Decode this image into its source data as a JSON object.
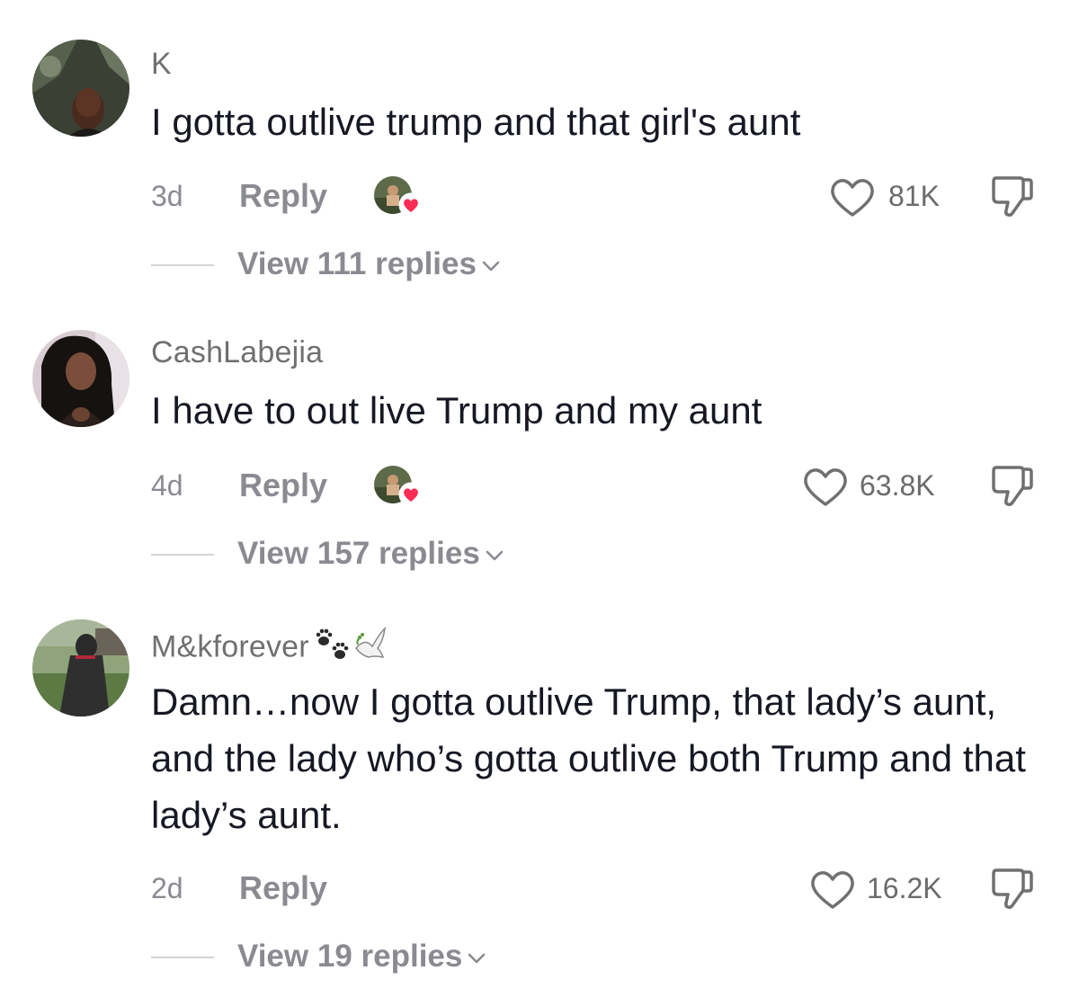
{
  "comments": [
    {
      "username": "K",
      "text": "I gotta outlive trump and that girl's aunt",
      "time": "3d",
      "reply_label": "Reply",
      "likes": "81K",
      "view_replies": "View 111 replies",
      "avatar_icon": "user-photo-avatar",
      "creator_liked": true
    },
    {
      "username": "CashLabejia",
      "text": "I have to out live Trump and my aunt",
      "time": "4d",
      "reply_label": "Reply",
      "likes": "63.8K",
      "view_replies": "View 157 replies",
      "avatar_icon": "user-photo-avatar",
      "creator_liked": true
    },
    {
      "username": "M&kforever",
      "username_emojis": [
        "paw-prints-icon",
        "dove-icon"
      ],
      "text": "Damn…now I gotta outlive Trump, that lady’s aunt, and the lady who’s gotta outlive both Trump and that lady’s aunt.",
      "time": "2d",
      "reply_label": "Reply",
      "likes": "16.2K",
      "view_replies": "View 19 replies",
      "avatar_icon": "dog-photo-avatar",
      "creator_liked": false
    }
  ],
  "colors": {
    "text": "#161823",
    "muted": "#8a8b91",
    "heart_red": "#fe2c55",
    "divider": "#d4d4d6"
  }
}
